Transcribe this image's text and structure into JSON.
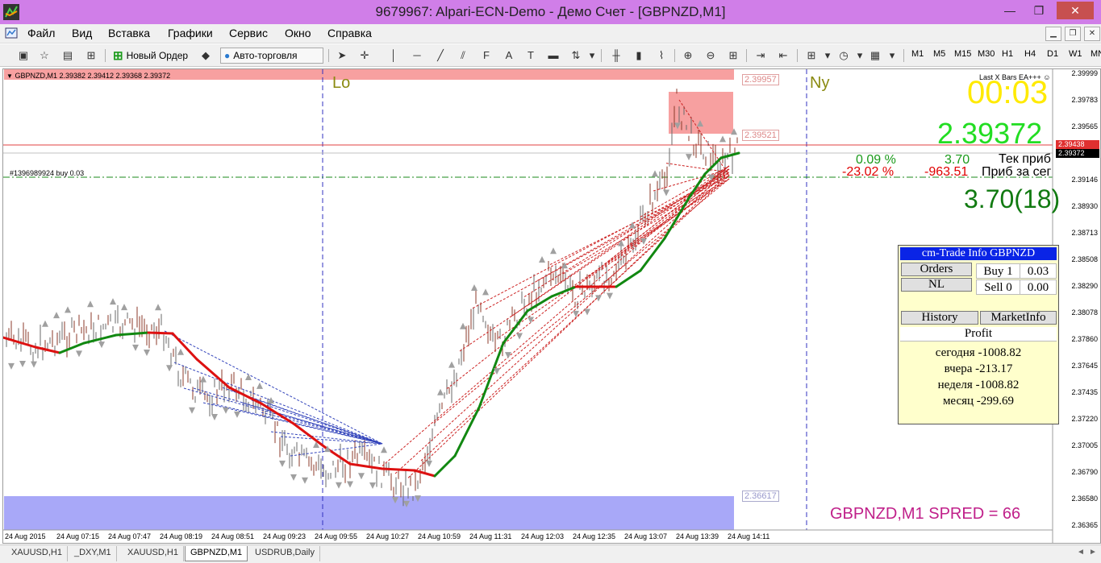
{
  "window": {
    "title": "9679967: Alpari-ECN-Demo - Демо Счет - [GBPNZD,M1]",
    "minimize": "—",
    "maximize": "❐",
    "close": "✕"
  },
  "menu": {
    "items": [
      "Файл",
      "Вид",
      "Вставка",
      "Графики",
      "Сервис",
      "Окно",
      "Справка"
    ]
  },
  "toolbar": {
    "new_order": "Новый Ордер",
    "auto_trading": "Авто-торговля",
    "text_tool": "A",
    "timeframes": [
      "M1",
      "M5",
      "M15",
      "M30",
      "H1",
      "H4",
      "D1",
      "W1",
      "MN"
    ]
  },
  "chart": {
    "header": "GBPNZD,M1  2.39382 2.39412 2.39368 2.39372",
    "order_line": "#1396989924 buy 0.03",
    "ea_label": "Last X Bars EA+++ ☺",
    "timer": "00:03",
    "current_price": "2.39372",
    "row1": {
      "pct": "0.09 %",
      "value": "3.70",
      "label": "Тек приб"
    },
    "row2": {
      "pct": "-23.02 %",
      "value": "-963.51",
      "label": "Приб за сег"
    },
    "profit_big": "3.70(18)",
    "zone_lo": "Lo",
    "zone_ny": "Ny",
    "spread": "GBPNZD,M1   SPRED = 66",
    "box_labels": {
      "top": "2.39957",
      "mid": "2.39521",
      "low": "2.36617"
    },
    "price_tags": {
      "ask": "2.39438",
      "bid": "2.39372"
    },
    "price_axis": [
      "2.39999",
      "2.39783",
      "2.39565",
      "2.39348",
      "2.39146",
      "2.38930",
      "2.38713",
      "2.38508",
      "2.38290",
      "2.38078",
      "2.37860",
      "2.37645",
      "2.37435",
      "2.37220",
      "2.37005",
      "2.36790",
      "2.36580",
      "2.36365"
    ],
    "time_axis": [
      "24 Aug 2015",
      "24 Aug 07:15",
      "24 Aug 07:47",
      "24 Aug 08:19",
      "24 Aug 08:51",
      "24 Aug 09:23",
      "24 Aug 09:55",
      "24 Aug 10:27",
      "24 Aug 10:59",
      "24 Aug 11:31",
      "24 Aug 12:03",
      "24 Aug 12:35",
      "24 Aug 13:07",
      "24 Aug 13:39",
      "24 Aug 14:11"
    ]
  },
  "panel": {
    "title": "cm-Trade Info GBPNZD",
    "orders_btn": "Orders",
    "nl_btn": "NL",
    "buy_label": "Buy 1",
    "buy_value": "0.03",
    "sell_label": "Sell 0",
    "sell_value": "0.00",
    "history_btn": "History",
    "marketinfo_btn": "MarketInfo",
    "profit_header": "Profit",
    "today": "сегодня -1008.82",
    "yesterday": "вчера -213.17",
    "week": "неделя -1008.82",
    "month": "месяц -299.69"
  },
  "tabs": [
    "XAUUSD,H1",
    "_DXY,M1",
    "XAUUSD,H1",
    "GBPNZD,M1",
    "USDRUB,Daily"
  ],
  "colors": {
    "titlebar": "#d07ee8",
    "bull_line": "#118811",
    "bear_line": "#dd1111",
    "resistance_zone": "#f7a0a0",
    "support_zone": "#a8a8f8",
    "panel_title": "#0a24e6"
  }
}
